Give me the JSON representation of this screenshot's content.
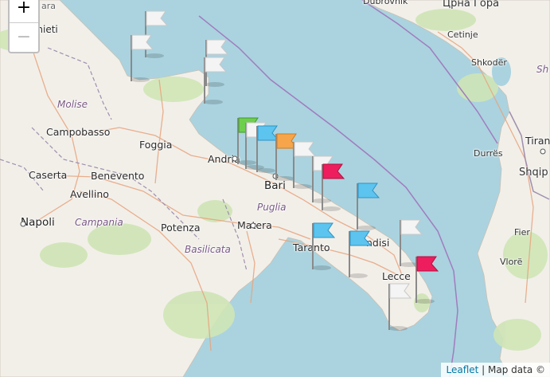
{
  "map": {
    "zoom_in_label": "+",
    "zoom_out_label": "−",
    "attribution": {
      "leaflet": "Leaflet",
      "separator": " | ",
      "text": "Map data ©"
    },
    "colors": {
      "sea": "#aad3df",
      "land": "#f2efe9",
      "park": "#cfe5b6",
      "border": "#9e8fae",
      "road": "#e8a37c"
    },
    "labels": {
      "chieti": "Chieti",
      "pescara_frag": "ara",
      "molise": "Molise",
      "campobasso": "Campobasso",
      "foggia": "Foggia",
      "caserta": "Caserta",
      "benevento": "Benevento",
      "avellino": "Avellino",
      "napoli": "Napoli",
      "campania": "Campania",
      "potenza": "Potenza",
      "basilicata": "Basilicata",
      "andria": "Andria",
      "bari": "Bari",
      "puglia": "Puglia",
      "matera": "Matera",
      "taranto": "Taranto",
      "brindisi": "ndisi",
      "lecce": "Lecce",
      "dubrovnik": "Dubrovnik",
      "montenegro": "Црна Гора",
      "cetinje": "Cetinje",
      "shkoder": "Shkodër",
      "durres": "Durrës",
      "tirana": "Tiran",
      "shqiperia": "Shqip",
      "fier": "Fier",
      "vlore": "Vlorë",
      "albania_sh": "Sh"
    },
    "flags": [
      {
        "name": "flag-gargano-1",
        "color": "white"
      },
      {
        "name": "flag-gargano-2",
        "color": "white"
      },
      {
        "name": "flag-gargano-3",
        "color": "white"
      },
      {
        "name": "flag-gargano-4",
        "color": "white"
      },
      {
        "name": "flag-barletta-green",
        "color": "green"
      },
      {
        "name": "flag-molfetta-white",
        "color": "white"
      },
      {
        "name": "flag-molfetta-blue",
        "color": "blue"
      },
      {
        "name": "flag-bari-orange",
        "color": "orange"
      },
      {
        "name": "flag-bari-white",
        "color": "white"
      },
      {
        "name": "flag-mola-white",
        "color": "white"
      },
      {
        "name": "flag-polignano-red",
        "color": "red"
      },
      {
        "name": "flag-ostuni-blue",
        "color": "blue"
      },
      {
        "name": "flag-taranto-blue",
        "color": "blue"
      },
      {
        "name": "flag-brindisi-blue",
        "color": "blue"
      },
      {
        "name": "flag-lecce-white",
        "color": "white"
      },
      {
        "name": "flag-otranto-red",
        "color": "red"
      },
      {
        "name": "flag-salento-white",
        "color": "white"
      }
    ]
  }
}
